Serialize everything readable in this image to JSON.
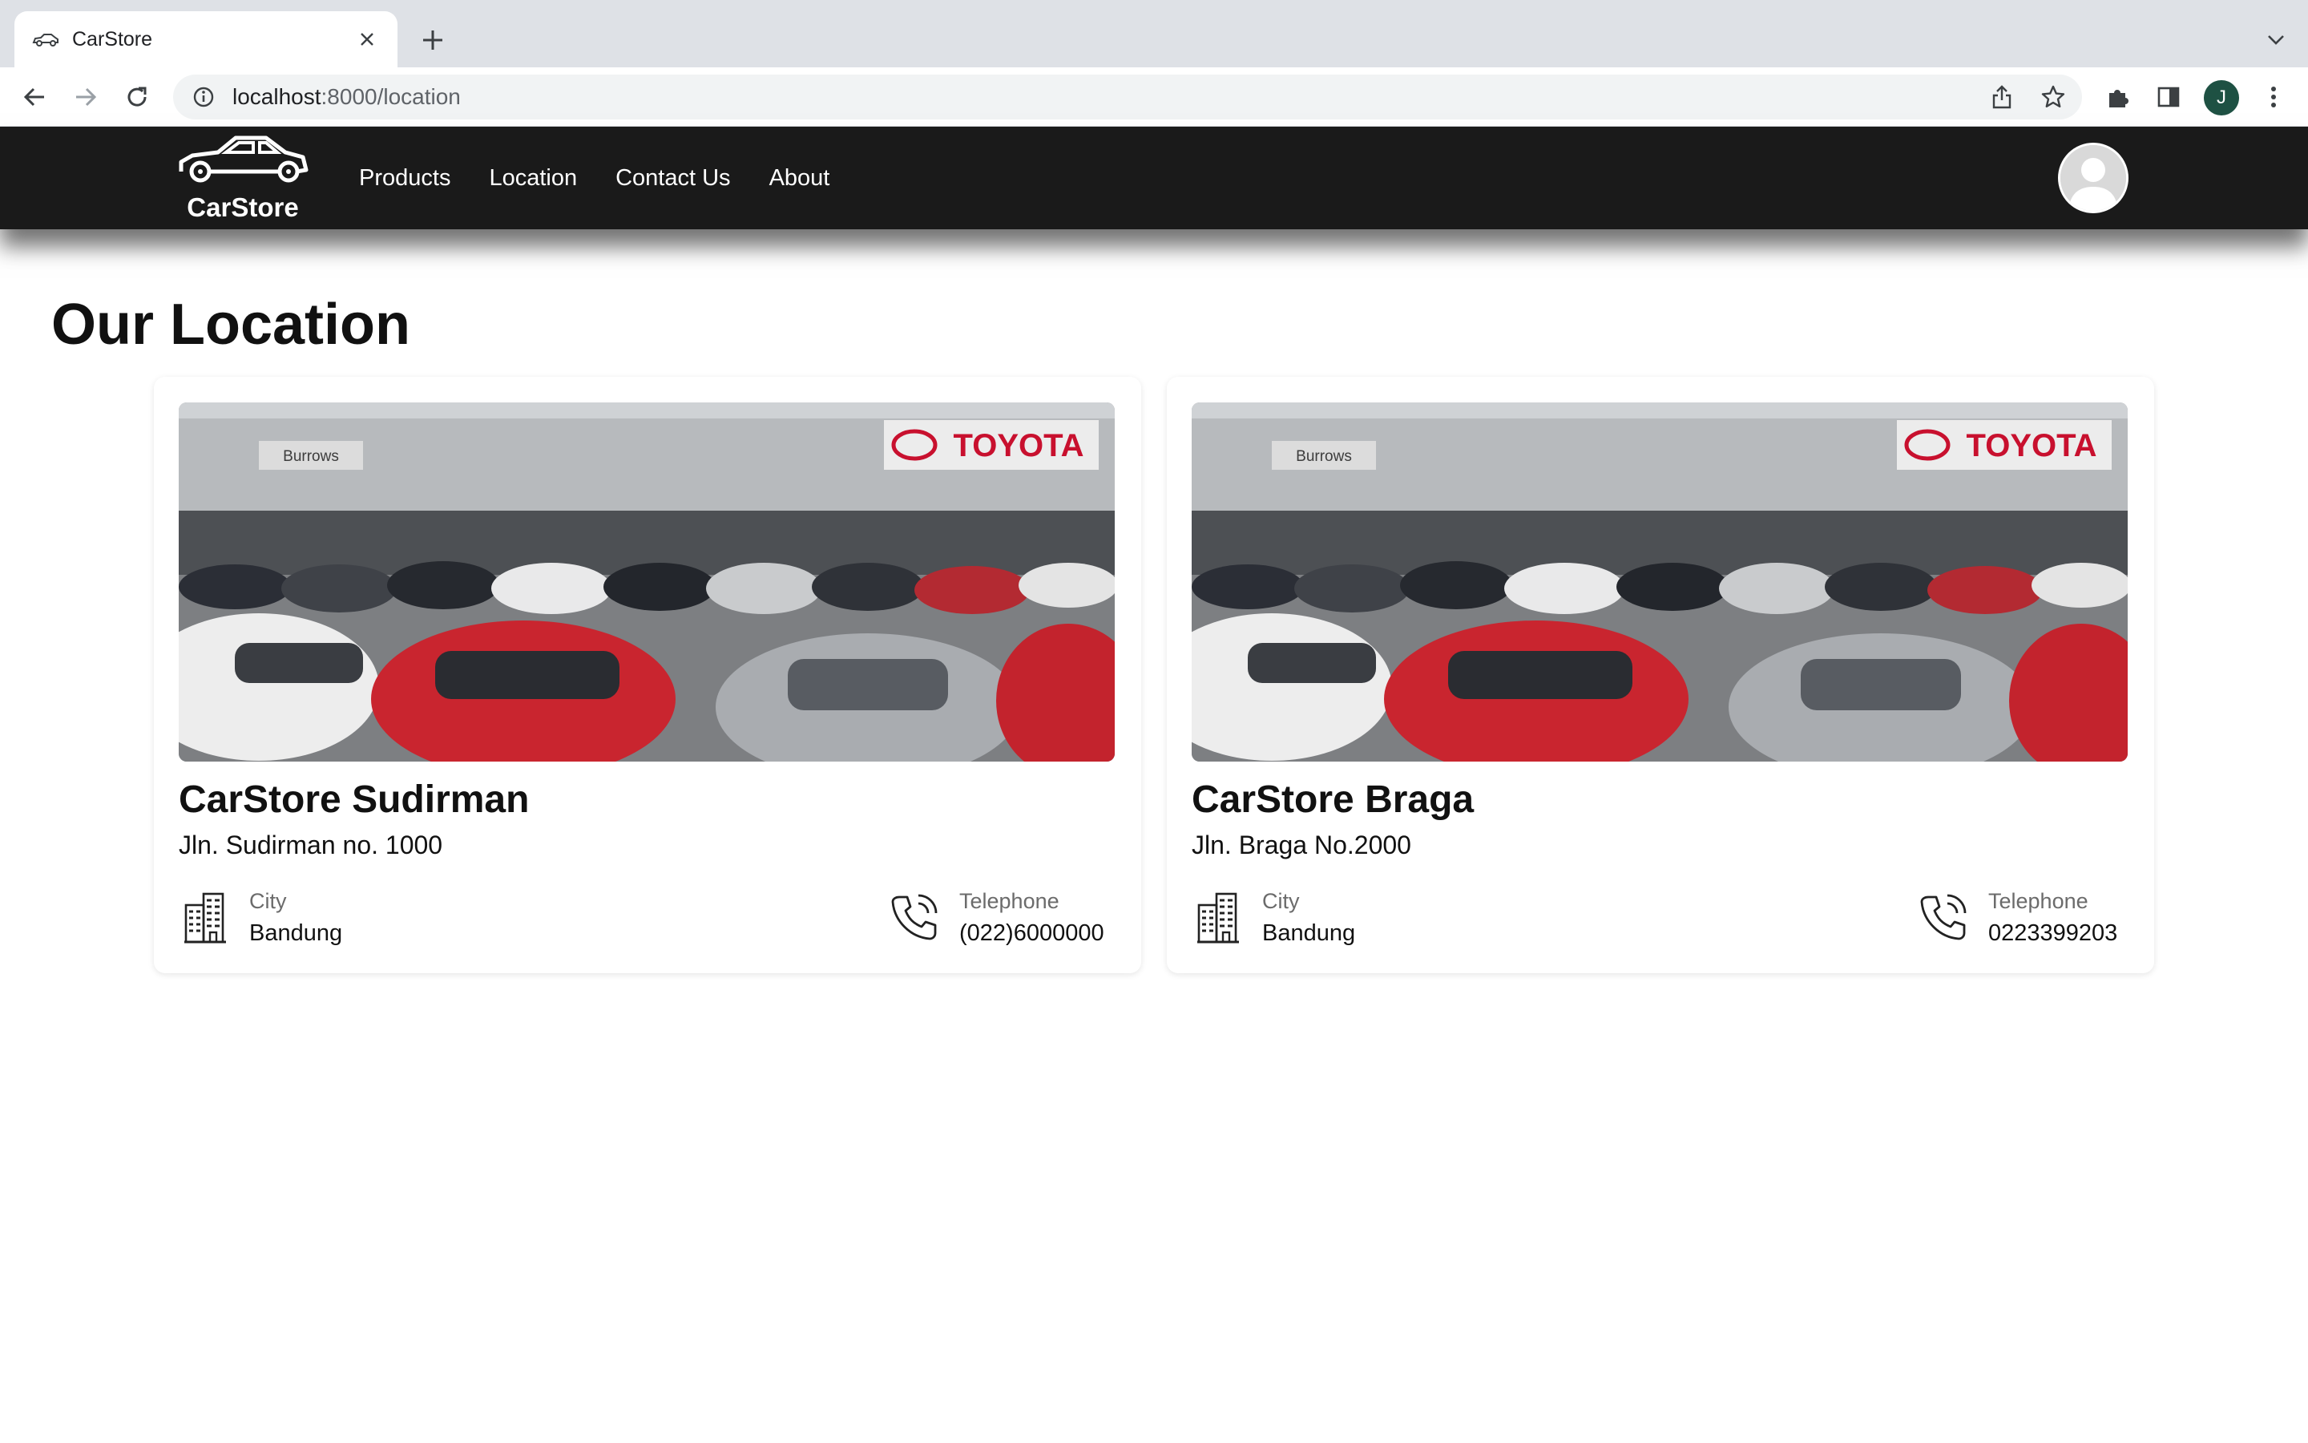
{
  "browser": {
    "tab_title": "CarStore",
    "url_host": "localhost",
    "url_path": ":8000/location",
    "profile_initial": "J",
    "profile_color": "#1e5143"
  },
  "site": {
    "brand": "CarStore",
    "nav": [
      {
        "label": "Products"
      },
      {
        "label": "Location"
      },
      {
        "label": "Contact Us"
      },
      {
        "label": "About"
      }
    ],
    "navbar_color": "#1a1a1a"
  },
  "page": {
    "title": "Our Location"
  },
  "locations": [
    {
      "name": "CarStore Sudirman",
      "address": "Jln. Sudirman no. 1000",
      "city_label": "City",
      "city": "Bandung",
      "phone_label": "Telephone",
      "phone": "(022)6000000",
      "photo_sign_left": "Burrows",
      "photo_sign_right": "TOYOTA"
    },
    {
      "name": "CarStore Braga",
      "address": "Jln. Braga No.2000",
      "city_label": "City",
      "city": "Bandung",
      "phone_label": "Telephone",
      "phone": "0223399203",
      "photo_sign_left": "Burrows",
      "photo_sign_right": "TOYOTA"
    }
  ],
  "icons": {
    "tab_favicon": "car-icon",
    "city": "building-icon",
    "phone": "phone-ringing-icon"
  }
}
